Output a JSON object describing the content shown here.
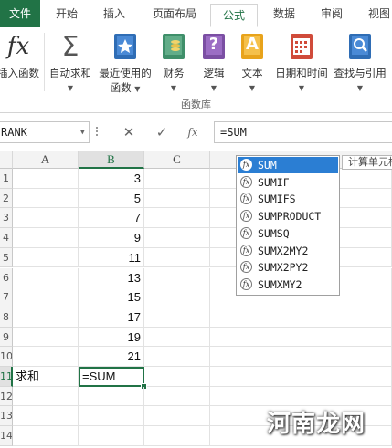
{
  "tabs": {
    "file": "文件",
    "home": "开始",
    "insert": "插入",
    "page_layout": "页面布局",
    "formulas": "公式",
    "data": "数据",
    "review": "审阅",
    "view": "视图"
  },
  "ribbon": {
    "insert_function": "插入函数",
    "autosum": "自动求和",
    "recent_line1": "最近使用的",
    "recent_line2": "函数",
    "financial": "财务",
    "logical": "逻辑",
    "text": "文本",
    "datetime": "日期和时间",
    "lookup": "查找与引用",
    "group_label": "函数库",
    "fx_glyph": "fx",
    "sigma_glyph": "Σ",
    "logical_glyph": "?",
    "text_glyph": "A"
  },
  "formula_bar": {
    "name_box": "RANK",
    "cancel": "✕",
    "enter": "✓",
    "fx": "fx",
    "value": "=SUM"
  },
  "grid": {
    "columns": [
      "A",
      "B",
      "C"
    ],
    "rows": [
      "1",
      "2",
      "3",
      "4",
      "5",
      "6",
      "7",
      "8",
      "9",
      "10",
      "11",
      "12",
      "13",
      "14"
    ],
    "b_values": [
      "3",
      "5",
      "7",
      "9",
      "11",
      "13",
      "15",
      "17",
      "19",
      "21"
    ],
    "a11_label": "求和",
    "b11_editing": "=SUM"
  },
  "autocomplete": {
    "items": [
      "SUM",
      "SUMIF",
      "SUMIFS",
      "SUMPRODUCT",
      "SUMSQ",
      "SUMX2MY2",
      "SUMX2PY2",
      "SUMXMY2"
    ],
    "selected": "SUM",
    "tooltip": "计算单元格区域中所有数值的和"
  },
  "watermark": "河南龙网",
  "colors": {
    "excel_green": "#217346",
    "highlight_blue": "#2b7ed3"
  }
}
